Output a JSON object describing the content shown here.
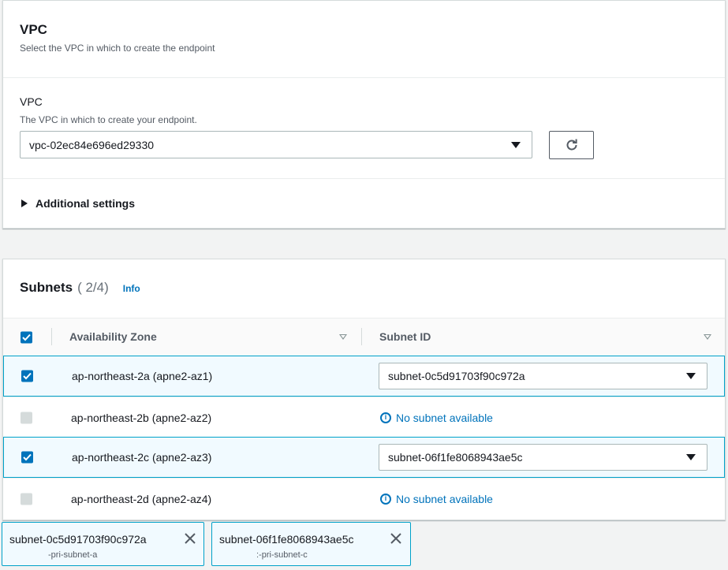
{
  "vpc_section": {
    "title": "VPC",
    "description": "Select the VPC in which to create the endpoint",
    "field_label": "VPC",
    "field_description": "The VPC in which to create your endpoint.",
    "selected_vpc": "vpc-02ec84e696ed29330",
    "additional_settings_label": "Additional settings"
  },
  "subnets_section": {
    "title": "Subnets",
    "count": "( 2/4)",
    "info_label": "Info",
    "columns": {
      "az": "Availability Zone",
      "subnet_id": "Subnet ID"
    },
    "rows": [
      {
        "az": "ap-northeast-2a (apne2-az1)",
        "checked": true,
        "subnet": "subnet-0c5d91703f90c972a"
      },
      {
        "az": "ap-northeast-2b (apne2-az2)",
        "checked": false,
        "subnet": "No subnet available"
      },
      {
        "az": "ap-northeast-2c (apne2-az3)",
        "checked": true,
        "subnet": "subnet-06f1fe8068943ae5c"
      },
      {
        "az": "ap-northeast-2d (apne2-az4)",
        "checked": false,
        "subnet": "No subnet available"
      }
    ]
  },
  "tokens": [
    {
      "id": "subnet-0c5d91703f90c972a",
      "name": "-pri-subnet-a"
    },
    {
      "id": "subnet-06f1fe8068943ae5c",
      "name": ":-pri-subnet-c"
    }
  ],
  "colors": {
    "accent": "#0073bb",
    "selected_border": "#00a1c9",
    "selected_bg": "#f1faff"
  }
}
